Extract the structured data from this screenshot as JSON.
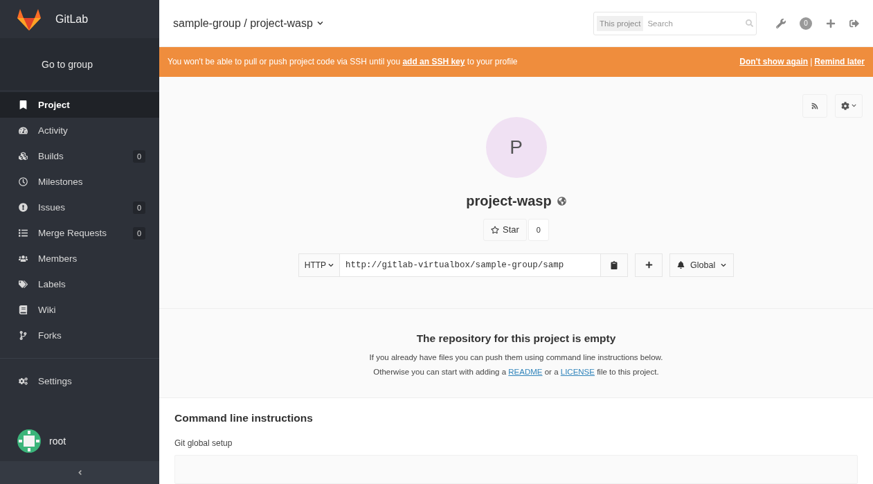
{
  "sidebar": {
    "brand": "GitLab",
    "go_to_group": "Go to group",
    "items": [
      {
        "label": "Project",
        "selected": true
      },
      {
        "label": "Activity",
        "selected": false
      },
      {
        "label": "Builds",
        "selected": false,
        "count": "0"
      },
      {
        "label": "Milestones",
        "selected": false
      },
      {
        "label": "Issues",
        "selected": false,
        "count": "0"
      },
      {
        "label": "Merge Requests",
        "selected": false,
        "count": "0"
      },
      {
        "label": "Members",
        "selected": false
      },
      {
        "label": "Labels",
        "selected": false
      },
      {
        "label": "Wiki",
        "selected": false
      },
      {
        "label": "Forks",
        "selected": false
      }
    ],
    "settings": {
      "label": "Settings",
      "selected": false
    },
    "user": "root"
  },
  "header": {
    "breadcrumb": "sample-group / project-wasp",
    "search_scope": "This project",
    "search_placeholder": "Search",
    "notification_count": "0"
  },
  "banner": {
    "text_before": "You won't be able to pull or push project code via SSH until you",
    "link": "add an SSH key",
    "text_after": "to your profile",
    "dismiss": "Don't show again",
    "separator": "|",
    "remind": "Remind later"
  },
  "project": {
    "avatar_letter": "P",
    "name": "project-wasp",
    "star_label": "Star",
    "star_count": "0",
    "protocol": "HTTP",
    "clone_url": "http://gitlab-virtualbox/sample-group/samp",
    "notification_level": "Global"
  },
  "empty_repo": {
    "title": "The repository for this project is empty",
    "line_1": "If you already have files you can push them using command line instructions below.",
    "line_2_before": "Otherwise you can start with adding a",
    "readme_link": "README",
    "line_2_middle": "or a",
    "license_link": "LICENSE",
    "line_2_after": "file to this project."
  },
  "instructions": {
    "title": "Command line instructions",
    "subtitle": "Git global setup"
  }
}
